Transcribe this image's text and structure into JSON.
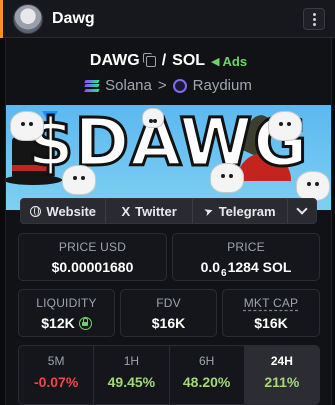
{
  "header": {
    "title": "Dawg"
  },
  "pair": {
    "base": "DAWG",
    "separator": "/",
    "quote": "SOL",
    "ads_label": "Ads",
    "chain": "Solana",
    "chevron": ">",
    "dex": "Raydium"
  },
  "banner": {
    "text": "$DAWG"
  },
  "links": {
    "website": "Website",
    "twitter": "Twitter",
    "telegram": "Telegram"
  },
  "stats": {
    "price_usd": {
      "label": "PRICE USD",
      "value": "$0.00001680"
    },
    "price_sol": {
      "label": "PRICE",
      "prefix": "0.0",
      "zeros": "6",
      "rest": "1284 SOL"
    },
    "liquidity": {
      "label": "LIQUIDITY",
      "value": "$12K"
    },
    "fdv": {
      "label": "FDV",
      "value": "$16K"
    },
    "mkt_cap": {
      "label": "MKT CAP",
      "value": "$16K"
    }
  },
  "changes": [
    {
      "label": "5M",
      "value": "-0.07%"
    },
    {
      "label": "1H",
      "value": "49.45%"
    },
    {
      "label": "6H",
      "value": "48.20%"
    },
    {
      "label": "24H",
      "value": "211%"
    }
  ],
  "colors": {
    "accent_orange": "#f7931a",
    "positive": "#a3d977",
    "negative": "#f0464a",
    "ads_green": "#6fd36b",
    "banner_sky": "#6ec5f2"
  },
  "icons": [
    "avatar-dog",
    "more-vertical-icon",
    "copy-icon",
    "megaphone-icon",
    "solana-icon",
    "raydium-icon",
    "globe-icon",
    "x-icon",
    "telegram-icon",
    "chevron-down-icon",
    "lock-icon"
  ]
}
